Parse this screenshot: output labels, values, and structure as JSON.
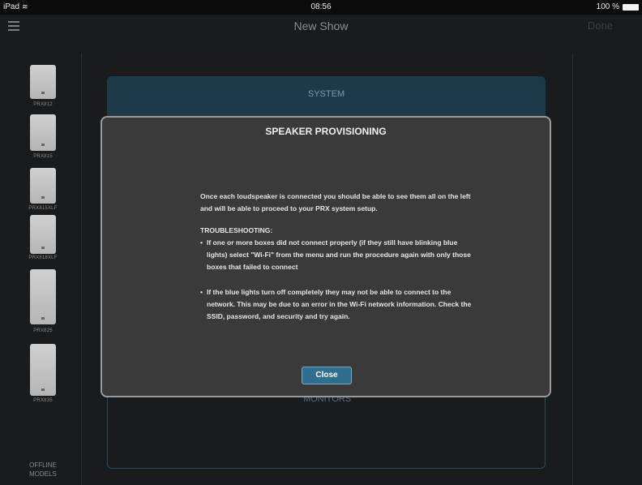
{
  "status_bar": {
    "device": "iPad",
    "time": "08:56",
    "battery": "100 %"
  },
  "nav": {
    "title": "New Show",
    "done": "Done"
  },
  "sidebar": {
    "speakers": [
      {
        "label": "PRX812"
      },
      {
        "label": "PRX815"
      },
      {
        "label": "PRX815XLF"
      },
      {
        "label": "PRX818XLF"
      },
      {
        "label": "PRX825"
      },
      {
        "label": "PRX835"
      }
    ],
    "offline_models": [
      "OFFLINE",
      "MODELS"
    ]
  },
  "panels": {
    "system": "SYSTEM",
    "monitors": "MONITORS"
  },
  "dialog": {
    "title": "SPEAKER PROVISIONING",
    "intro": "Once each loudspeaker is connected you should be able to see them all on the left and will be able to proceed to your PRX system setup.",
    "troubleshooting_heading": "TROUBLESHOOTING:",
    "bullets": [
      "If one or more boxes did not connect properly (if they still have blinking blue lights) select \"Wi-Fi\" from the menu and run the procedure again with only those boxes that failed to connect",
      "If the blue lights turn off completely they may not be able to connect to the network. This may be due to an error in the Wi-Fi network information. Check the SSID, password, and security and try again."
    ],
    "close_label": "Close"
  }
}
